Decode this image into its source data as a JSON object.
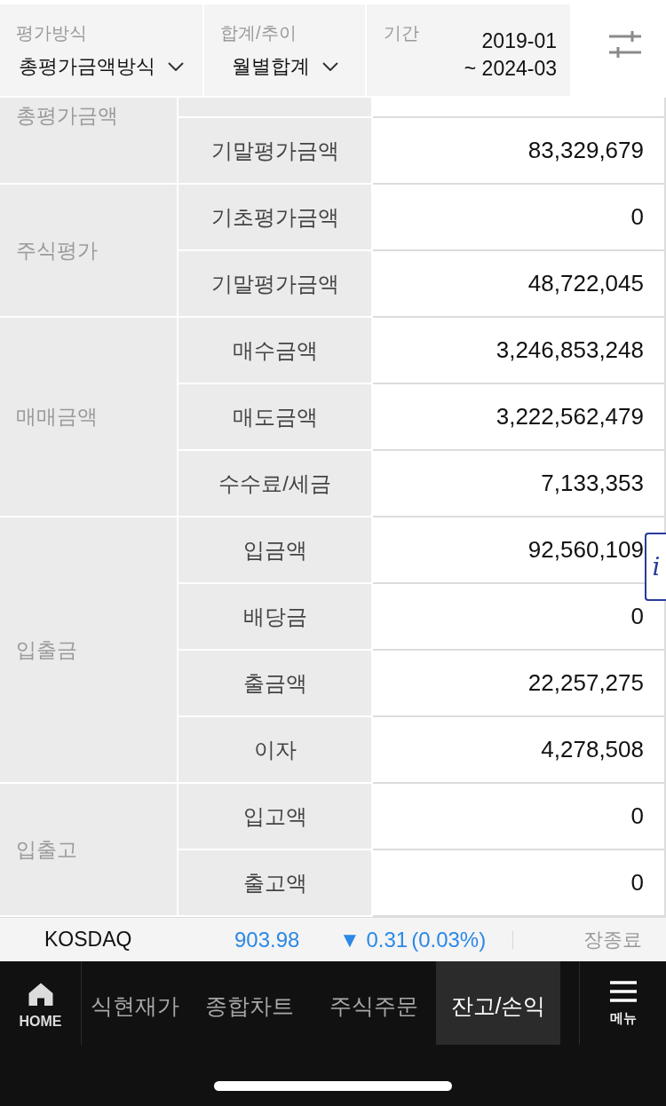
{
  "filters": [
    {
      "kind": "dropdown",
      "label": "평가방식",
      "value": "총평가금액방식"
    },
    {
      "kind": "dropdown",
      "label": "합계/추이",
      "value": "월별합계"
    },
    {
      "kind": "period",
      "label": "기간",
      "start": "2019-01",
      "end": "~ 2024-03"
    }
  ],
  "table": {
    "groups": [
      {
        "label": "총평가금액",
        "clipped_top": true,
        "rows": [
          {
            "item": "기말평가금액",
            "value": "83,329,679"
          }
        ]
      },
      {
        "label": "주식평가",
        "clipped_top": false,
        "rows": [
          {
            "item": "기초평가금액",
            "value": "0"
          },
          {
            "item": "기말평가금액",
            "value": "48,722,045"
          }
        ]
      },
      {
        "label": "매매금액",
        "clipped_top": false,
        "rows": [
          {
            "item": "매수금액",
            "value": "3,246,853,248"
          },
          {
            "item": "매도금액",
            "value": "3,222,562,479"
          },
          {
            "item": "수수료/세금",
            "value": "7,133,353"
          }
        ]
      },
      {
        "label": "입출금",
        "clipped_top": false,
        "rows": [
          {
            "item": "입금액",
            "value": "92,560,109"
          },
          {
            "item": "배당금",
            "value": "0"
          },
          {
            "item": "출금액",
            "value": "22,257,275"
          },
          {
            "item": "이자",
            "value": "4,278,508"
          }
        ]
      },
      {
        "label": "입출고",
        "clipped_top": false,
        "rows": [
          {
            "item": "입고액",
            "value": "0"
          },
          {
            "item": "출고액",
            "value": "0"
          }
        ]
      }
    ]
  },
  "info_button": {
    "label": "i"
  },
  "ticker": {
    "index": "KOSDAQ",
    "price": "903.98",
    "down": true,
    "change": "▼ 0.31",
    "rate": "(0.03%)",
    "status": "장종료"
  },
  "nav": {
    "home": "HOME",
    "tabs": [
      {
        "label": "식현재가",
        "selected": false
      },
      {
        "label": "종합차트",
        "selected": false
      },
      {
        "label": "주식주문",
        "selected": false
      },
      {
        "label": "잔고/손익",
        "selected": true
      }
    ],
    "menu": "메뉴"
  }
}
